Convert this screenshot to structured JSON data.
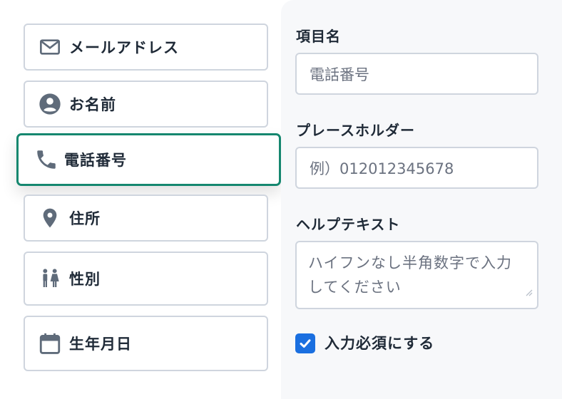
{
  "field_list": {
    "items": [
      {
        "label": "メールアドレス",
        "icon": "mail-icon"
      },
      {
        "label": "お名前",
        "icon": "person-icon"
      },
      {
        "label": "電話番号",
        "icon": "phone-icon",
        "selected": true
      },
      {
        "label": "住所",
        "icon": "location-pin-icon"
      },
      {
        "label": "性別",
        "icon": "gender-icon"
      },
      {
        "label": "生年月日",
        "icon": "calendar-icon"
      }
    ]
  },
  "settings": {
    "name_label": "項目名",
    "name_value": "電話番号",
    "placeholder_label": "プレースホルダー",
    "placeholder_value": "例）012012345678",
    "help_label": "ヘルプテキスト",
    "help_value": "ハイフンなし半角数字で入力してください",
    "required_label": "入力必須にする",
    "required_checked": true
  },
  "colors": {
    "selected_border": "#15876f",
    "checkbox": "#1a6fe0",
    "icon": "#5f6b7a"
  }
}
